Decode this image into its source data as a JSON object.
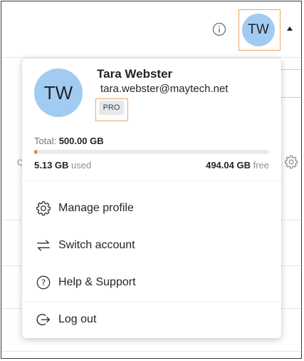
{
  "header": {
    "avatar_initials": "TW"
  },
  "profile": {
    "avatar_initials": "TW",
    "name": "Tara Webster",
    "email": "tara.webster@maytech.net",
    "plan_badge": "PRO"
  },
  "storage": {
    "total_label": "Total:",
    "total_value": "500.00 GB",
    "used_value": "5.13 GB",
    "used_label": "used",
    "free_value": "494.04 GB",
    "free_label": "free",
    "used_fraction": 0.0103
  },
  "menu": {
    "items": [
      {
        "label": "Manage profile",
        "icon": "gear-icon"
      },
      {
        "label": "Switch account",
        "icon": "switch-arrows-icon"
      },
      {
        "label": "Help & Support",
        "icon": "help-circle-icon"
      },
      {
        "label": "Log out",
        "icon": "logout-icon"
      }
    ]
  },
  "colors": {
    "avatar_bg": "#a2cbf2",
    "highlight_border": "#f0a35a",
    "progress_fill": "#f07a24"
  }
}
